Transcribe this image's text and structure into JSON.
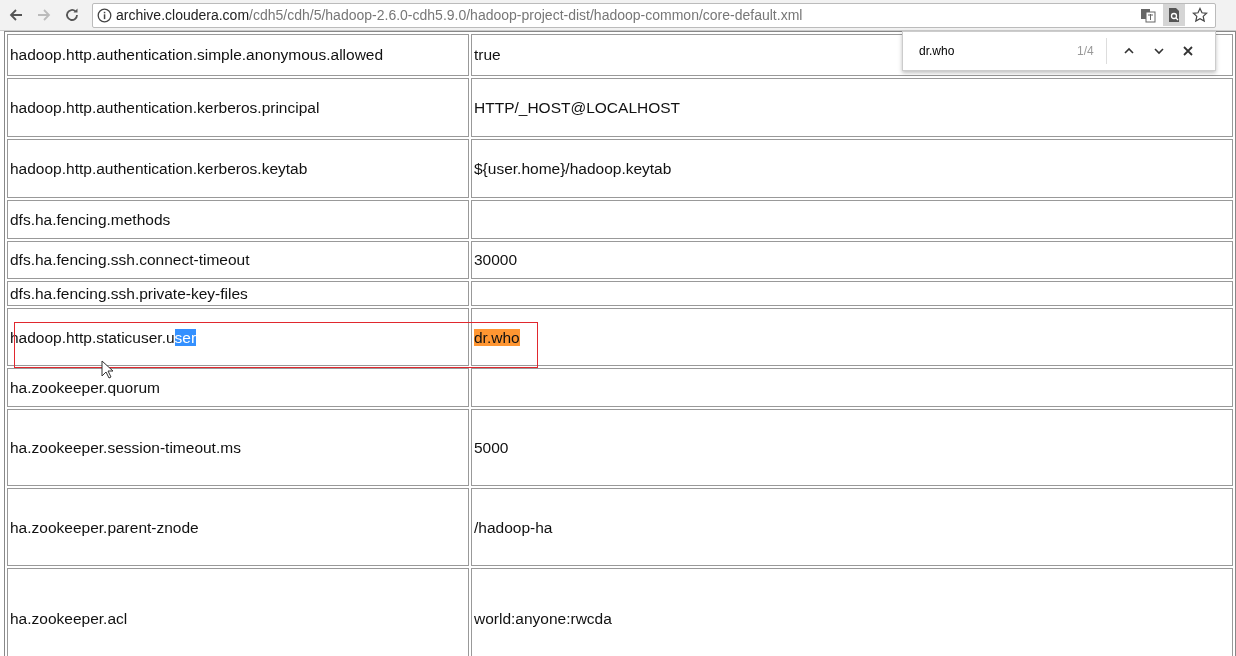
{
  "browser": {
    "url_host": "archive.cloudera.com",
    "url_path": "/cdh5/cdh/5/hadoop-2.6.0-cdh5.9.0/hadoop-project-dist/hadoop-common/core-default.xml",
    "forward_disabled": true,
    "find_active": true
  },
  "find_bar": {
    "query": "dr.who",
    "count": "1/4"
  },
  "table": {
    "rows": [
      {
        "name": "hadoop.http.authentication.simple.anonymous.allowed",
        "value": "true",
        "find_match": false,
        "annotated": false
      },
      {
        "name": "hadoop.http.authentication.kerberos.principal",
        "value": "HTTP/_HOST@LOCALHOST",
        "find_match": false,
        "annotated": false
      },
      {
        "name": "hadoop.http.authentication.kerberos.keytab",
        "value": "${user.home}/hadoop.keytab",
        "find_match": false,
        "annotated": false
      },
      {
        "name": "dfs.ha.fencing.methods",
        "find_match": false,
        "annotated": false
      },
      {
        "name": "dfs.ha.fencing.ssh.connect-timeout",
        "value": "30000",
        "find_match": false,
        "annotated": false
      },
      {
        "name": "dfs.ha.fencing.ssh.private-key-files",
        "find_match": false,
        "annotated": false
      },
      {
        "name": "hadoop.http.staticuser.u",
        "name_selected": "ser",
        "value": "dr.who",
        "find_match": true,
        "annotated": true
      },
      {
        "name": "ha.zookeeper.quorum",
        "find_match": false,
        "annotated": false
      },
      {
        "name": "ha.zookeeper.session-timeout.ms",
        "value": "5000",
        "find_match": false,
        "annotated": false
      },
      {
        "name": "ha.zookeeper.parent-znode",
        "value": "/hadoop-ha",
        "find_match": false,
        "annotated": false
      },
      {
        "name": "ha.zookeeper.acl",
        "value": "world:anyone:rwcda",
        "find_match": false,
        "annotated": false
      }
    ]
  }
}
